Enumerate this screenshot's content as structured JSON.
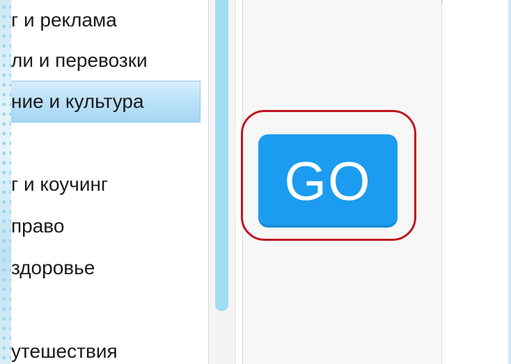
{
  "categories": {
    "items": [
      {
        "label": "г и реклама"
      },
      {
        "label": "ли и перевозки"
      },
      {
        "label": "ние и культура"
      },
      {
        "label": ""
      },
      {
        "label": "г и коучинг"
      },
      {
        "label": "право"
      },
      {
        "label": "здоровье"
      },
      {
        "label": ""
      },
      {
        "label": "утешествия"
      }
    ],
    "selected_index": 2
  },
  "action": {
    "go_label": "GO"
  },
  "colors": {
    "go_button": "#1b9cf0",
    "highlight_ring": "#c0141c",
    "selected_item": "#b9e0f8",
    "scroll_thumb": "#9fdcf6"
  }
}
